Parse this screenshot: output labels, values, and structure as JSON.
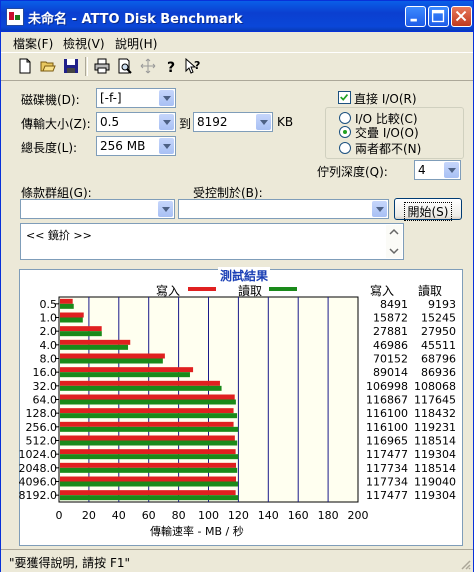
{
  "window": {
    "title": "未命名 - ATTO Disk Benchmark"
  },
  "menu": [
    "檔案(F)",
    "檢視(V)",
    "說明(H)"
  ],
  "toolbar": {
    "icons": [
      "new-icon",
      "open-icon",
      "save-icon",
      "print-icon",
      "print-preview-icon",
      "move-icon",
      "help-icon",
      "context-help-icon"
    ]
  },
  "controls": {
    "drive_label": "磁碟機(D):",
    "drive_value": "[-f-]",
    "transfer_label": "傳輸大小(Z):",
    "transfer_from": "0.5",
    "transfer_to_label": "到",
    "transfer_to": "8192",
    "transfer_unit": "KB",
    "total_label": "總長度(L):",
    "total_value": "256 MB",
    "direct_io_label": "直接 I/O(R)",
    "radio_compare": "I/O 比較(C)",
    "radio_overlap": "交疊 I/O(O)",
    "radio_neither": "兩者都不(N)",
    "queue_label": "佇列深度(Q):",
    "queue_value": "4",
    "group_label": "條款群組(G):",
    "controlled_label": "受控制於(B):",
    "start_button": "開始(S)",
    "memo_text": "<< 鏡扴 >>"
  },
  "results": {
    "title": "測試結果",
    "legend_write": "寫入",
    "legend_read": "讀取",
    "col_write": "寫入",
    "col_read": "讀取",
    "xlabel": "傳輸速率 - MB / 秒",
    "write_color": "#e02020",
    "read_color": "#1a8a1a"
  },
  "chart_data": {
    "type": "bar",
    "title": "測試結果",
    "xlabel": "傳輸速率 - MB / 秒",
    "xlim": [
      0,
      200
    ],
    "xticks": [
      0,
      20,
      40,
      60,
      80,
      100,
      120,
      140,
      160,
      180,
      200
    ],
    "categories": [
      "0.5",
      "1.0",
      "2.0",
      "4.0",
      "8.0",
      "16.0",
      "32.0",
      "64.0",
      "128.0",
      "256.0",
      "512.0",
      "1024.0",
      "2048.0",
      "4096.0",
      "8192.0"
    ],
    "series": [
      {
        "name": "寫入",
        "values": [
          8491,
          15872,
          27881,
          46986,
          70152,
          89014,
          106998,
          116867,
          116100,
          116100,
          116965,
          117477,
          117734,
          117734,
          117477
        ]
      },
      {
        "name": "讀取",
        "values": [
          9193,
          15245,
          27950,
          45511,
          68796,
          86936,
          108068,
          117645,
          118432,
          119231,
          118514,
          119304,
          118514,
          119040,
          119304
        ]
      }
    ]
  },
  "status": {
    "text": "\"要獲得說明, 請按 F1\""
  }
}
